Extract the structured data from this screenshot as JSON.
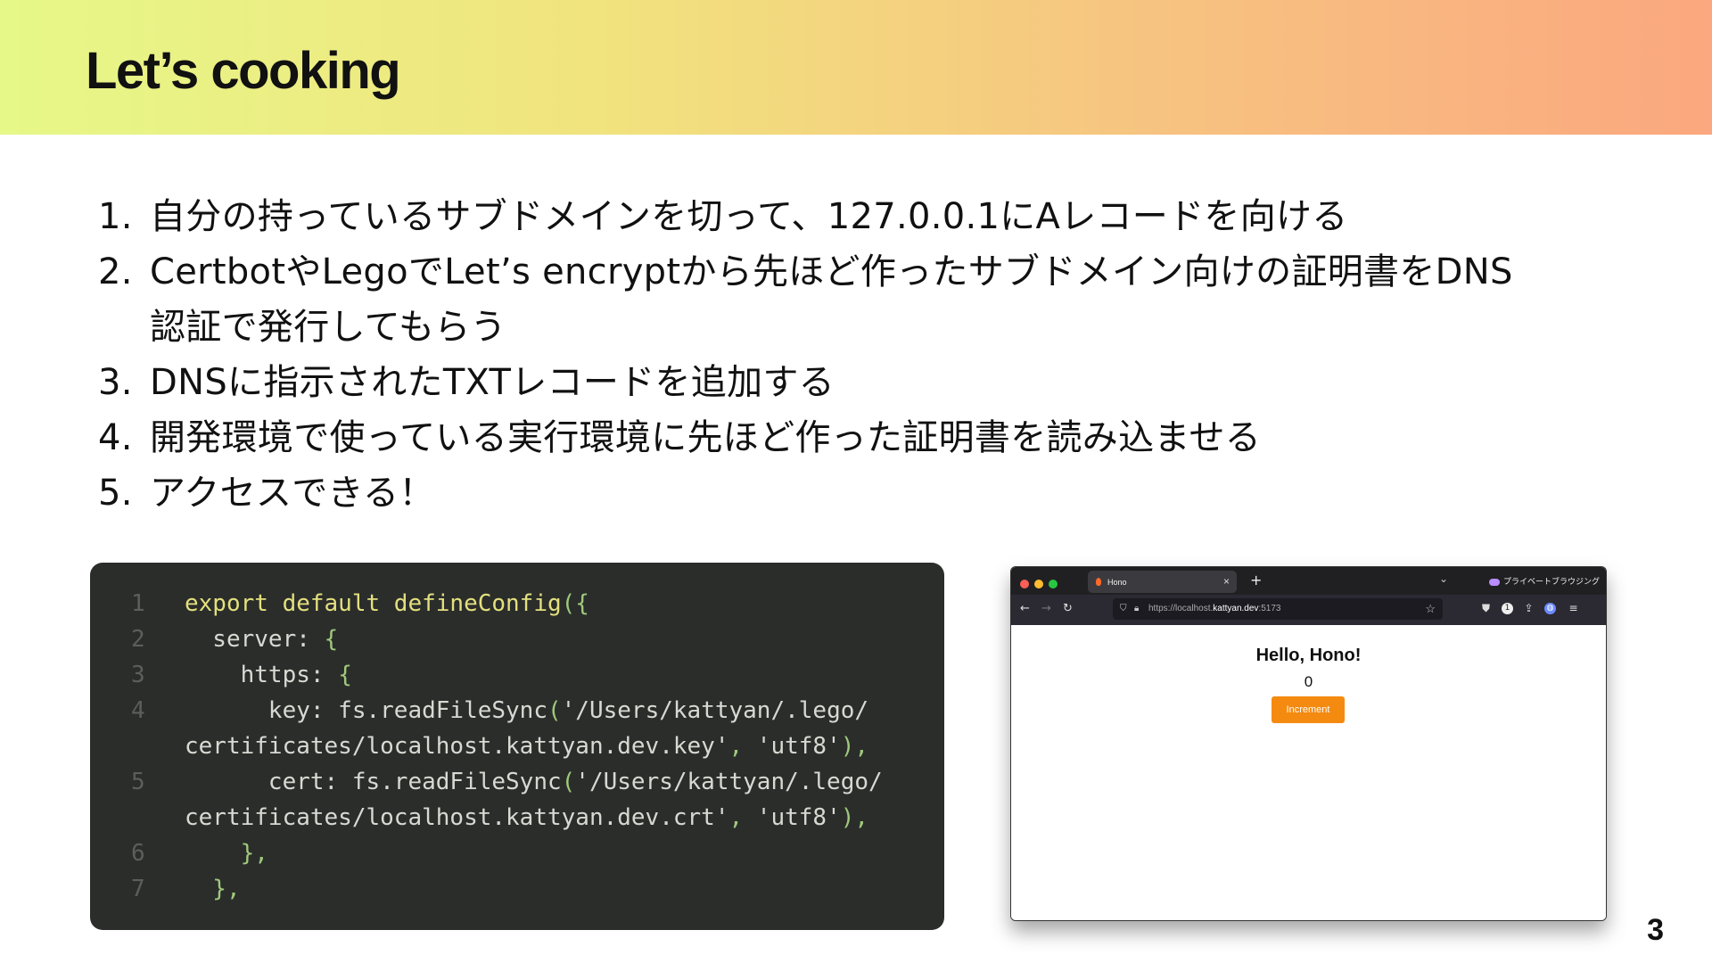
{
  "slide": {
    "title": "Let’s cooking",
    "page_number": "3"
  },
  "steps": [
    {
      "num": "1.",
      "text": "自分の持っているサブドメインを切って、127.0.0.1にAレコードを向ける"
    },
    {
      "num": "2.",
      "text": "CertbotやLegoでLet’s encryptから先ほど作ったサブドメイン向けの証明書をDNS",
      "text2": "認証で発行してもらう"
    },
    {
      "num": "3.",
      "text": "DNSに指示されたTXTレコードを追加する"
    },
    {
      "num": "4.",
      "text": "開発環境で使っている実行環境に先ほど作った証明書を読み込ませる"
    },
    {
      "num": "5.",
      "text": "アクセスできる！"
    }
  ],
  "code": {
    "line_numbers": [
      "1",
      "2",
      "3",
      "4",
      "5",
      "6",
      "7"
    ],
    "tokens": {
      "l1a": "export default defineConfig",
      "l1b": "({",
      "l2a": "  server: ",
      "l2b": "{",
      "l3a": "    https: ",
      "l3b": "{",
      "l4a": "      key: fs.readFileSync",
      "l4b": "(",
      "l4c": "'/Users/kattyan/.lego/",
      "l4d": "certificates/localhost.kattyan.dev.key'",
      "l4e": ", ",
      "l4f": "'utf8'",
      "l4g": "),",
      "l5a": "      cert: fs.readFileSync",
      "l5b": "(",
      "l5c": "'/Users/kattyan/.lego/",
      "l5d": "certificates/localhost.kattyan.dev.crt'",
      "l5e": ", ",
      "l5f": "'utf8'",
      "l5g": "),",
      "l6": "    },",
      "l7": "  },"
    }
  },
  "browser": {
    "tab_title": "Hono",
    "tab_close": "×",
    "new_tab": "+",
    "tab_menu": "⌄",
    "private_label": "プライベートブラウジング",
    "url_prefix": "https://localhost.",
    "url_host": "kattyan.dev",
    "url_suffix": ":5173",
    "page": {
      "heading": "Hello, Hono!",
      "count": "0",
      "button_label": "Increment"
    },
    "colors": {
      "accent_button": "#f48a10"
    },
    "icons": [
      "back-icon",
      "forward-icon",
      "reload-icon",
      "shield-icon",
      "lock-icon",
      "star-icon",
      "pocket-icon",
      "extension-icon",
      "share-icon",
      "account-icon",
      "menu-icon"
    ]
  }
}
